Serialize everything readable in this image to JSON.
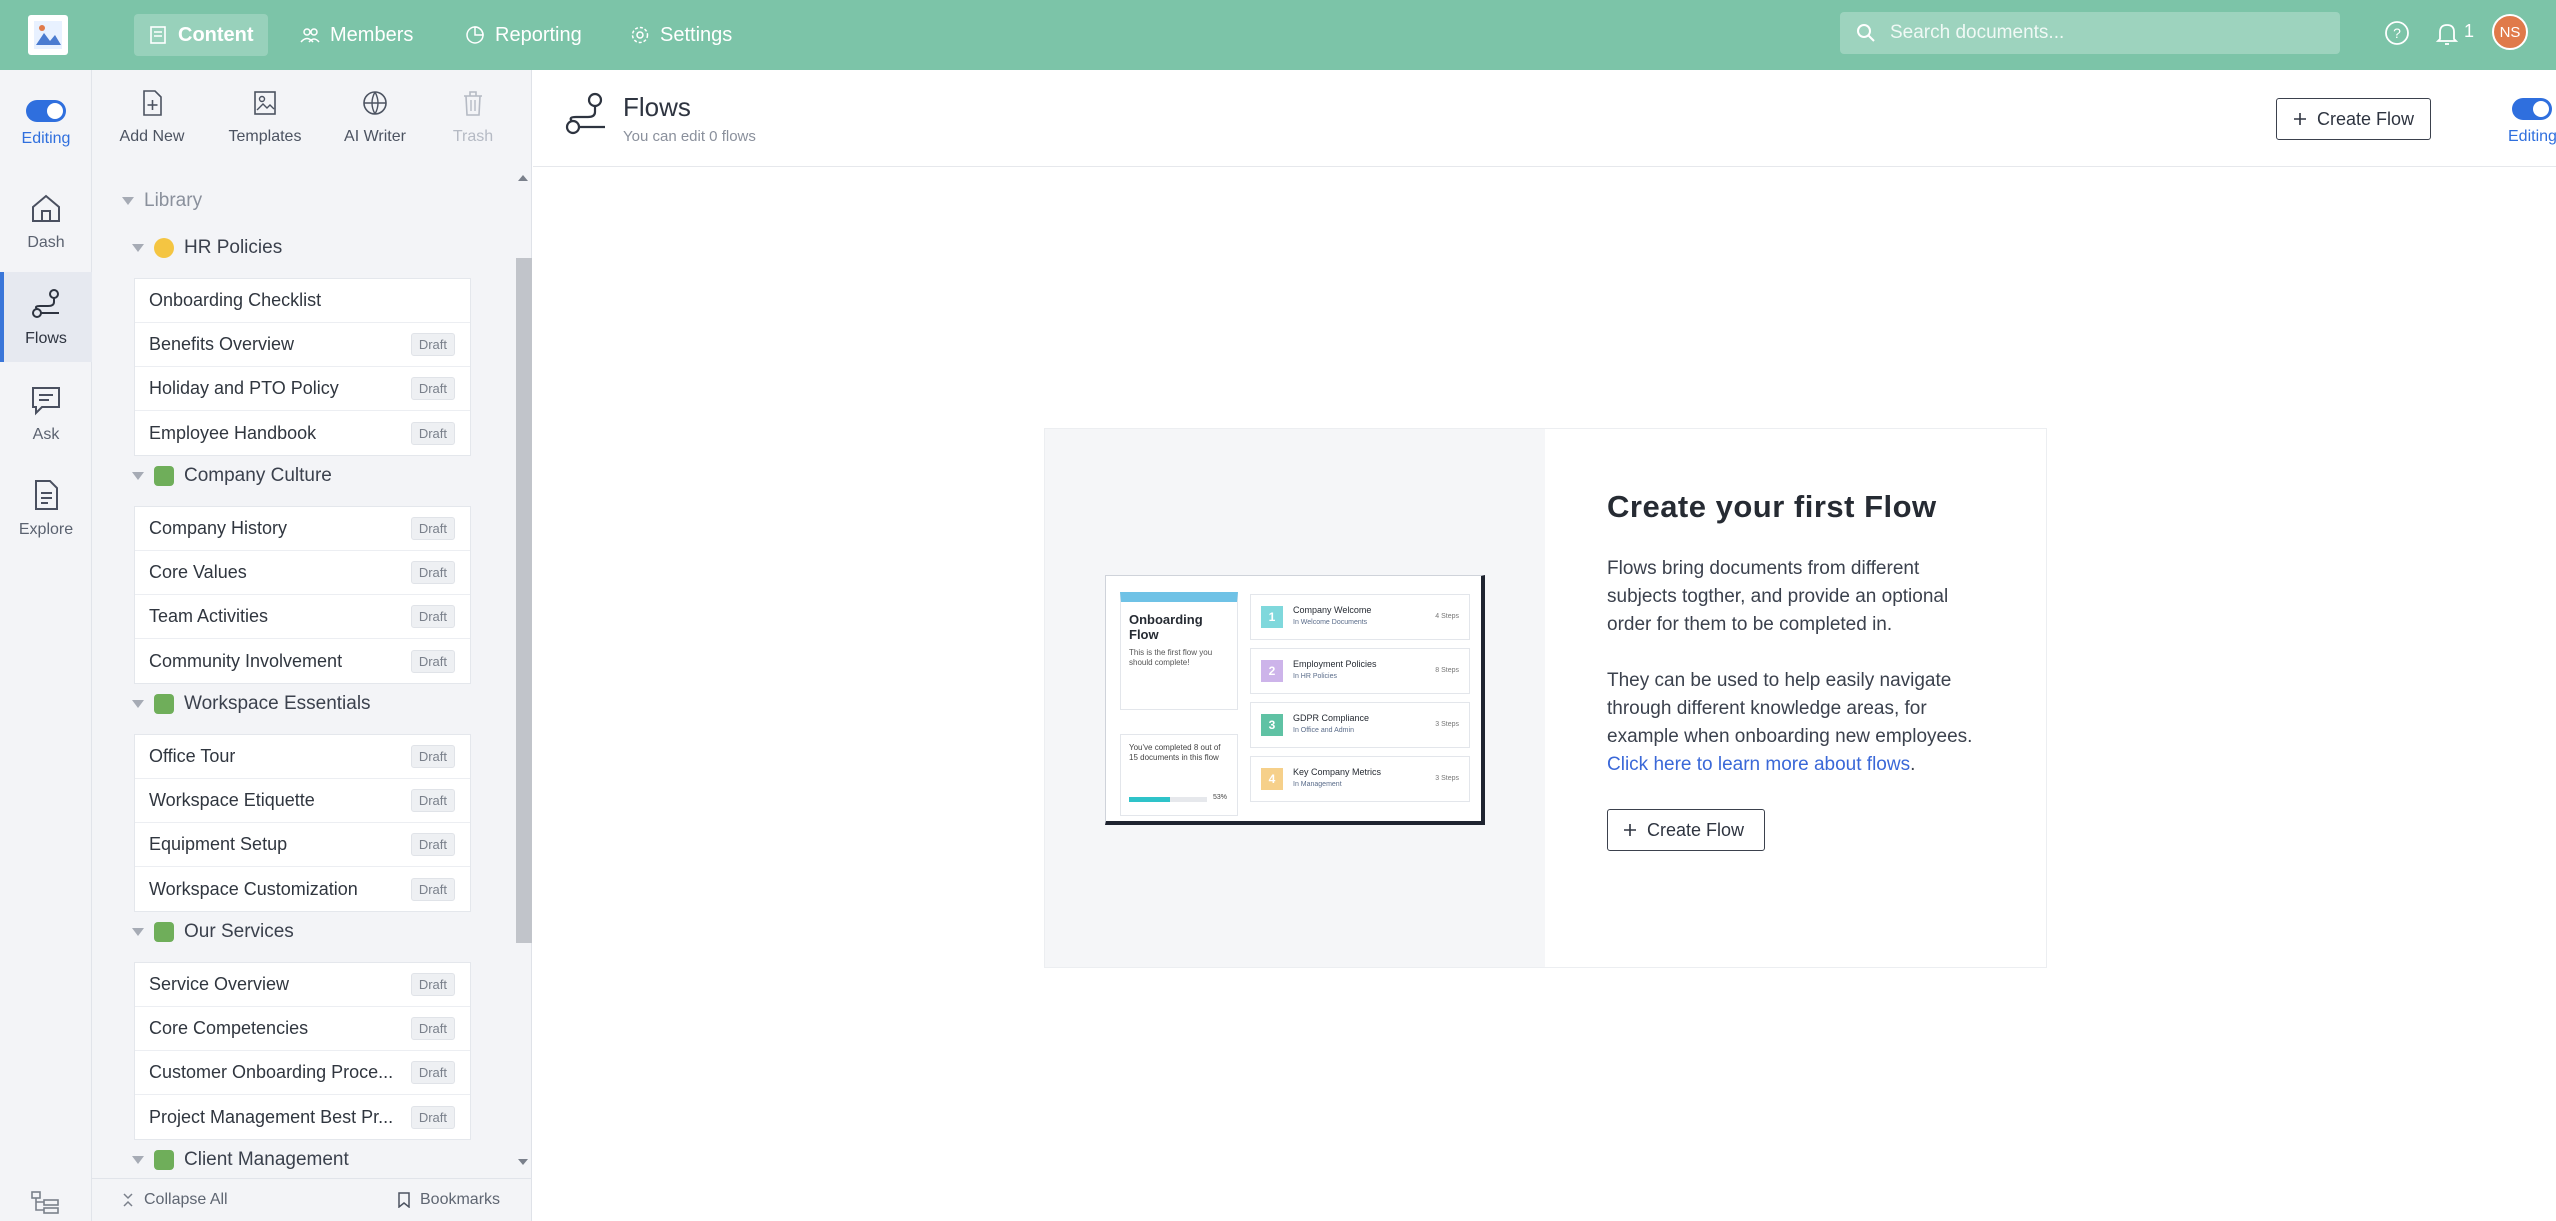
{
  "topbar": {
    "nav": [
      {
        "label": "Content",
        "icon": "content-icon"
      },
      {
        "label": "Members",
        "icon": "members-icon"
      },
      {
        "label": "Reporting",
        "icon": "reporting-icon"
      },
      {
        "label": "Settings",
        "icon": "settings-icon"
      }
    ],
    "search_placeholder": "Search documents...",
    "notification_count": "1",
    "avatar_initials": "NS",
    "brand_color": "#7cc4a8"
  },
  "rail": {
    "editing_label": "Editing",
    "items": [
      {
        "label": "Dash",
        "icon": "home-icon"
      },
      {
        "label": "Flows",
        "icon": "flows-icon"
      },
      {
        "label": "Ask",
        "icon": "chat-icon"
      },
      {
        "label": "Explore",
        "icon": "document-icon"
      }
    ]
  },
  "panel": {
    "tools": [
      {
        "label": "Add New",
        "icon": "add-document-icon"
      },
      {
        "label": "Templates",
        "icon": "templates-icon"
      },
      {
        "label": "AI Writer",
        "icon": "ai-writer-icon"
      },
      {
        "label": "Trash",
        "icon": "trash-icon"
      }
    ],
    "library_label": "Library",
    "categories": [
      {
        "name": "HR Policies",
        "docs": [
          {
            "title": "Onboarding Checklist",
            "badge": ""
          },
          {
            "title": "Benefits Overview",
            "badge": "Draft"
          },
          {
            "title": "Holiday and PTO Policy",
            "badge": "Draft"
          },
          {
            "title": "Employee Handbook",
            "badge": "Draft"
          }
        ]
      },
      {
        "name": "Company Culture",
        "docs": [
          {
            "title": "Company History",
            "badge": "Draft"
          },
          {
            "title": "Core Values",
            "badge": "Draft"
          },
          {
            "title": "Team Activities",
            "badge": "Draft"
          },
          {
            "title": "Community Involvement",
            "badge": "Draft"
          }
        ]
      },
      {
        "name": "Workspace Essentials",
        "docs": [
          {
            "title": "Office Tour",
            "badge": "Draft"
          },
          {
            "title": "Workspace Etiquette",
            "badge": "Draft"
          },
          {
            "title": "Equipment Setup",
            "badge": "Draft"
          },
          {
            "title": "Workspace Customization",
            "badge": "Draft"
          }
        ]
      },
      {
        "name": "Our Services",
        "docs": [
          {
            "title": "Service Overview",
            "badge": "Draft"
          },
          {
            "title": "Core Competencies",
            "badge": "Draft"
          },
          {
            "title": "Customer Onboarding Proce...",
            "badge": "Draft"
          },
          {
            "title": "Project Management Best Pr...",
            "badge": "Draft"
          }
        ]
      },
      {
        "name": "Client Management",
        "docs": []
      }
    ],
    "collapse_all_label": "Collapse All",
    "bookmarks_label": "Bookmarks"
  },
  "main": {
    "title": "Flows",
    "subtitle": "You can edit 0 flows",
    "create_flow_label": "Create Flow",
    "editing_label": "Editing"
  },
  "empty_state": {
    "title": "Create your first Flow",
    "paragraph1": "Flows bring documents from different subjects togther, and provide an optional order for them to be completed in.",
    "paragraph2_prefix": "They can be used to help easily navigate through different knowledge areas, for example when onboarding new employees. ",
    "link_text": "Click here to learn more about flows",
    "paragraph2_suffix": ".",
    "button_label": "Create Flow",
    "preview": {
      "card_title": "Onboarding Flow",
      "card_subtitle": "This is the first flow you should complete!",
      "progress_text": "You've completed 8 out of 15 documents in this flow",
      "progress_pct_label": "53%",
      "progress_value": 0.53,
      "steps": [
        {
          "num": "1",
          "title": "Company Welcome",
          "sub": "In Welcome Documents",
          "count": "4 Steps",
          "color": "#7fd8dc"
        },
        {
          "num": "2",
          "title": "Employment Policies",
          "sub": "In HR Policies",
          "count": "8 Steps",
          "color": "#cdb4ea"
        },
        {
          "num": "3",
          "title": "GDPR Compliance",
          "sub": "In Office and Admin",
          "count": "3 Steps",
          "color": "#5fc2a4"
        },
        {
          "num": "4",
          "title": "Key Company Metrics",
          "sub": "In Management",
          "count": "3 Steps",
          "color": "#f6d08a"
        }
      ]
    }
  }
}
